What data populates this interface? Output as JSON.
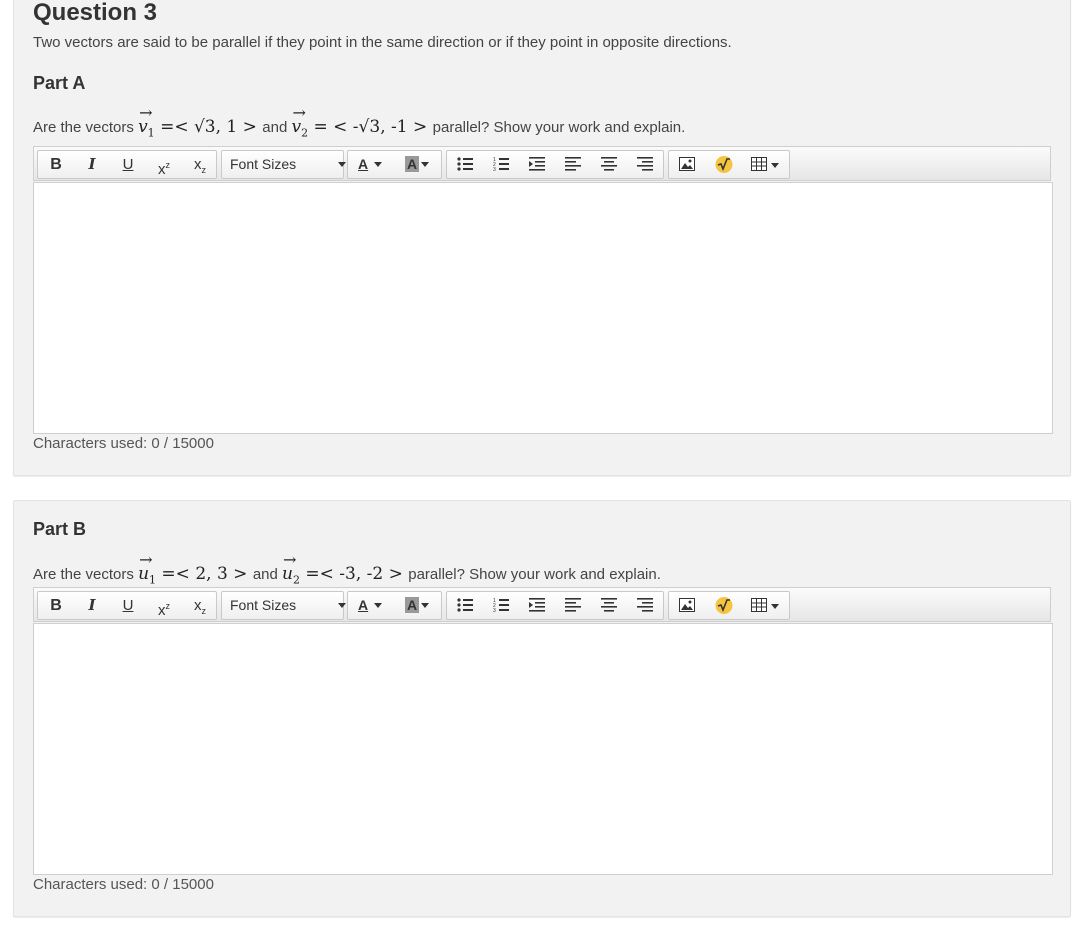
{
  "question": {
    "title": "Question 3",
    "description": "Two vectors are said to be parallel if they point in the same direction or if they point in opposite directions."
  },
  "toolbar": {
    "bold": "B",
    "italic": "I",
    "underline": "U",
    "superscript": "x",
    "subscript": "x",
    "font_sizes": "Font Sizes",
    "text_color": "A",
    "bg_color": "A",
    "icons": [
      "bold-icon",
      "italic-icon",
      "underline-icon",
      "superscript-icon",
      "subscript-icon",
      "bulleted-list-icon",
      "numbered-list-icon",
      "indent-icon",
      "align-left-icon",
      "align-center-icon",
      "align-right-icon",
      "image-icon",
      "math-formula-icon",
      "table-icon"
    ]
  },
  "partA": {
    "title": "Part A",
    "prompt_pre": "Are the vectors",
    "v1_label": "v",
    "v1_sub": "1",
    "v1_value": "=< √3, 1 >",
    "and": "and",
    "v2_label": "v",
    "v2_sub": "2",
    "v2_value": "= < -√3, -1 >",
    "prompt_post": "parallel? Show your work and explain.",
    "editor_value": "",
    "chars_used": "Characters used: 0 / 15000"
  },
  "partB": {
    "title": "Part B",
    "prompt_pre": "Are the vectors",
    "u1_label": "u",
    "u1_sub": "1",
    "u1_value": "=< 2, 3 >",
    "and": "and",
    "u2_label": "u",
    "u2_sub": "2",
    "u2_value": "=< -3, -2 >",
    "prompt_post": "parallel? Show your work and explain.",
    "editor_value": "",
    "chars_used": "Characters used: 0 / 15000"
  },
  "colors": {
    "card_bg": "#f2f2f2",
    "math_button": "#f5c542"
  }
}
